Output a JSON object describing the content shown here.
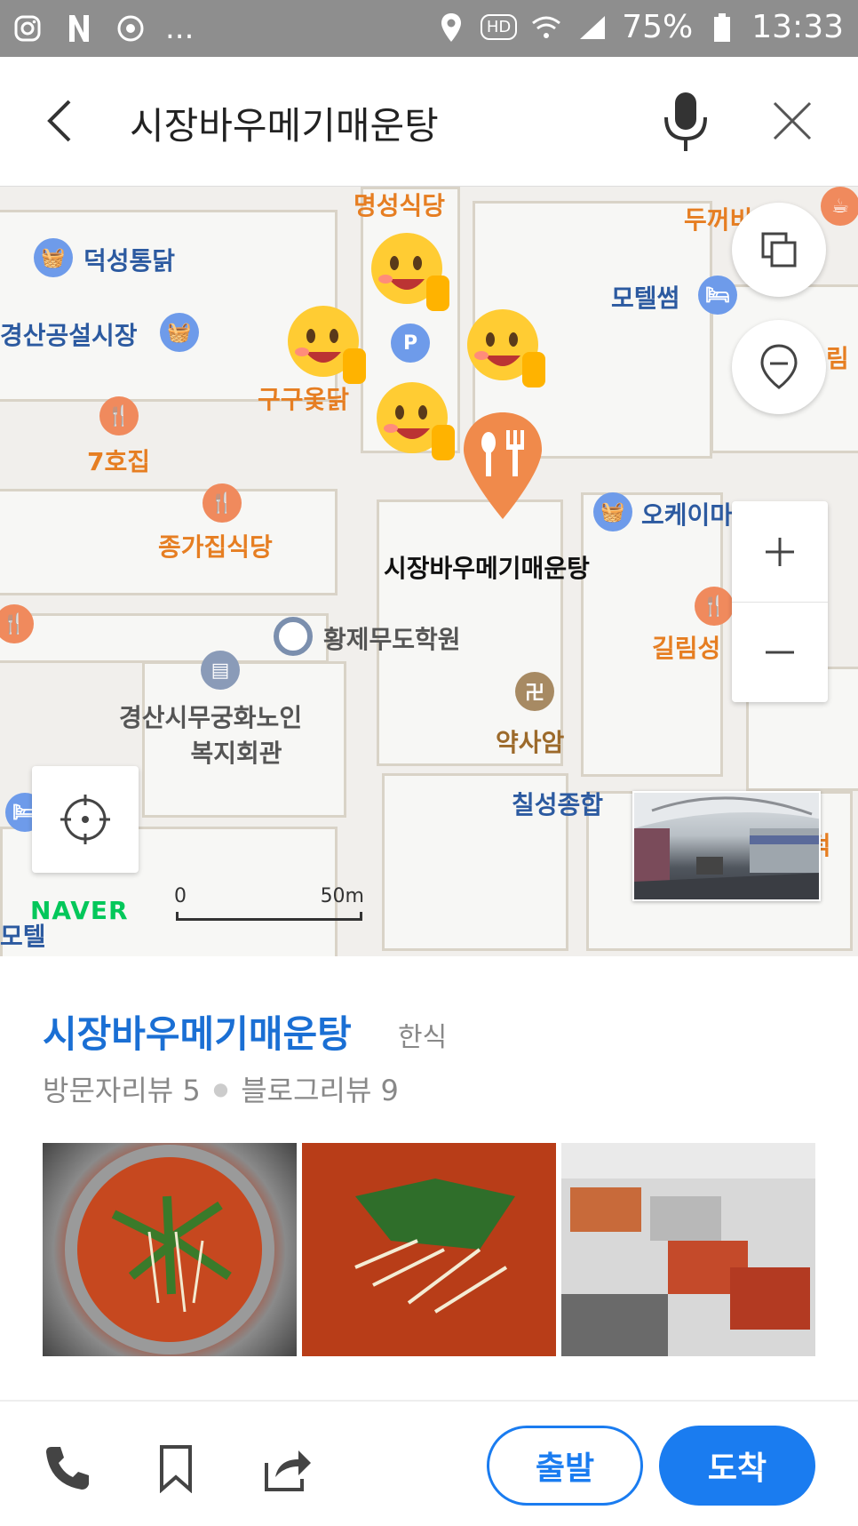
{
  "status_bar": {
    "battery": "75%",
    "time": "13:33",
    "more": "...",
    "hd": "HD"
  },
  "search": {
    "query": "시장바우메기매운탕"
  },
  "map": {
    "selected_label": "시장바우메기매운탕",
    "pois": {
      "myeongseong": "명성식당",
      "deokseong": "덕성통닭",
      "gyeongsan_market": "경산공설시장",
      "gugu": "구구옻닭",
      "hojip": "7호집",
      "jongga": "종가집식당",
      "dukkeobi": "두꺼비",
      "motel_sseom": "모텔썸",
      "rim": "림",
      "okay": "오케이마",
      "hwangje": "황제무도학원",
      "senior_center_line1": "경산시무궁화노인",
      "senior_center_line2": "복지회관",
      "yaksaam": "약사암",
      "chilseong": "칠성종합",
      "gilrim": "길림성",
      "kkudeok": "꾸덕",
      "motel_left": "모텔",
      "parking": "P"
    },
    "scale": {
      "start": "0",
      "end": "50m"
    },
    "naver_logo": "NAVER"
  },
  "place": {
    "name": "시장바우메기매운탕",
    "category": "한식",
    "visitor_reviews": "방문자리뷰 5",
    "blog_reviews": "블로그리뷰 9"
  },
  "actions": {
    "depart_label": "출발",
    "arrive_label": "도착"
  }
}
